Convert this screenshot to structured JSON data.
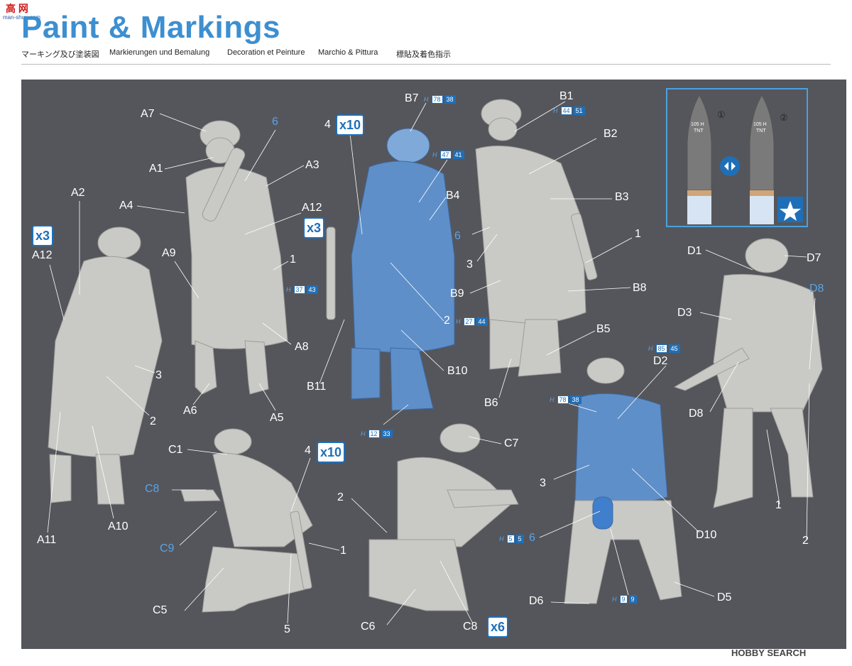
{
  "logo": {
    "text": "高 网",
    "url": "man-shuu.com"
  },
  "header": {
    "title": "Paint & Markings",
    "subtitles": [
      "マーキング及び塗装図",
      "Markierungen und Bemalung",
      "Decoration et Peinture",
      "Marchio & Pittura",
      "標貼及着色指示"
    ]
  },
  "labels": {
    "A7": "A7",
    "A1": "A1",
    "A3": "A3",
    "A2": "A2",
    "A4": "A4",
    "A12a": "A12",
    "A12b": "A12",
    "A9": "A9",
    "A8": "A8",
    "A6": "A6",
    "A5": "A5",
    "A11": "A11",
    "A10": "A10",
    "six_a": "6",
    "one_a": "1",
    "three_a": "3",
    "two_a": "2",
    "B7": "B7",
    "B1": "B1",
    "B2": "B2",
    "B3": "B3",
    "B4": "B4",
    "B9": "B9",
    "B8": "B8",
    "B5": "B5",
    "B6": "B6",
    "B10": "B10",
    "B11": "B11",
    "four_b": "4",
    "six_b": "6",
    "three_b": "3",
    "one_b": "1",
    "two_b": "2",
    "C1": "C1",
    "C7": "C7",
    "C8": "C8",
    "C9": "C9",
    "C5": "C5",
    "C6": "C6",
    "C8b": "C8",
    "four_c": "4",
    "one_c": "1",
    "five_c": "5",
    "two_c": "2",
    "D1": "D1",
    "D7": "D7",
    "D8": "D8",
    "D3": "D3",
    "D2": "D2",
    "D8b": "D8",
    "D10": "D10",
    "D6": "D6",
    "D5": "D5",
    "three_d": "3",
    "six_d": "6",
    "one_d": "1",
    "two_d": "2"
  },
  "multipliers": {
    "x3_left": "x3",
    "x3_mid": "x3",
    "x10_top": "x10",
    "x10_bottom": "x10",
    "x6": "x6"
  },
  "paint_codes": {
    "b7": {
      "h": "H",
      "a": "78",
      "b": "38"
    },
    "b1": {
      "h": "H",
      "a": "44",
      "b": "51"
    },
    "b4": {
      "h": "H",
      "a": "47",
      "b": "41"
    },
    "a_h": {
      "h": "H",
      "a": "37",
      "b": "43"
    },
    "b2": {
      "h": "H",
      "a": "27",
      "b": "44"
    },
    "b_feet": {
      "h": "H",
      "a": "12",
      "b": "33"
    },
    "d2": {
      "h": "H",
      "a": "85",
      "b": "45"
    },
    "d_coat": {
      "h": "H",
      "a": "78",
      "b": "38"
    },
    "d_six": {
      "h": "H",
      "a": "5",
      "b": "5"
    },
    "d_nine": {
      "h": "H",
      "a": "9",
      "b": "9"
    }
  },
  "inset": {
    "shell1": {
      "num": "①",
      "text1": "105 H",
      "text2": "TNT"
    },
    "shell2": {
      "num": "②",
      "text1": "105 H",
      "text2": "TNT"
    }
  },
  "footer": {
    "brand": "HOBBY SEARCH"
  },
  "colors": {
    "title": "#3d8fd0",
    "panel": "#55565b",
    "figure": "#c9c9c6",
    "blue_figure": "#5e8fc9",
    "accent": "#1f6fb8"
  }
}
